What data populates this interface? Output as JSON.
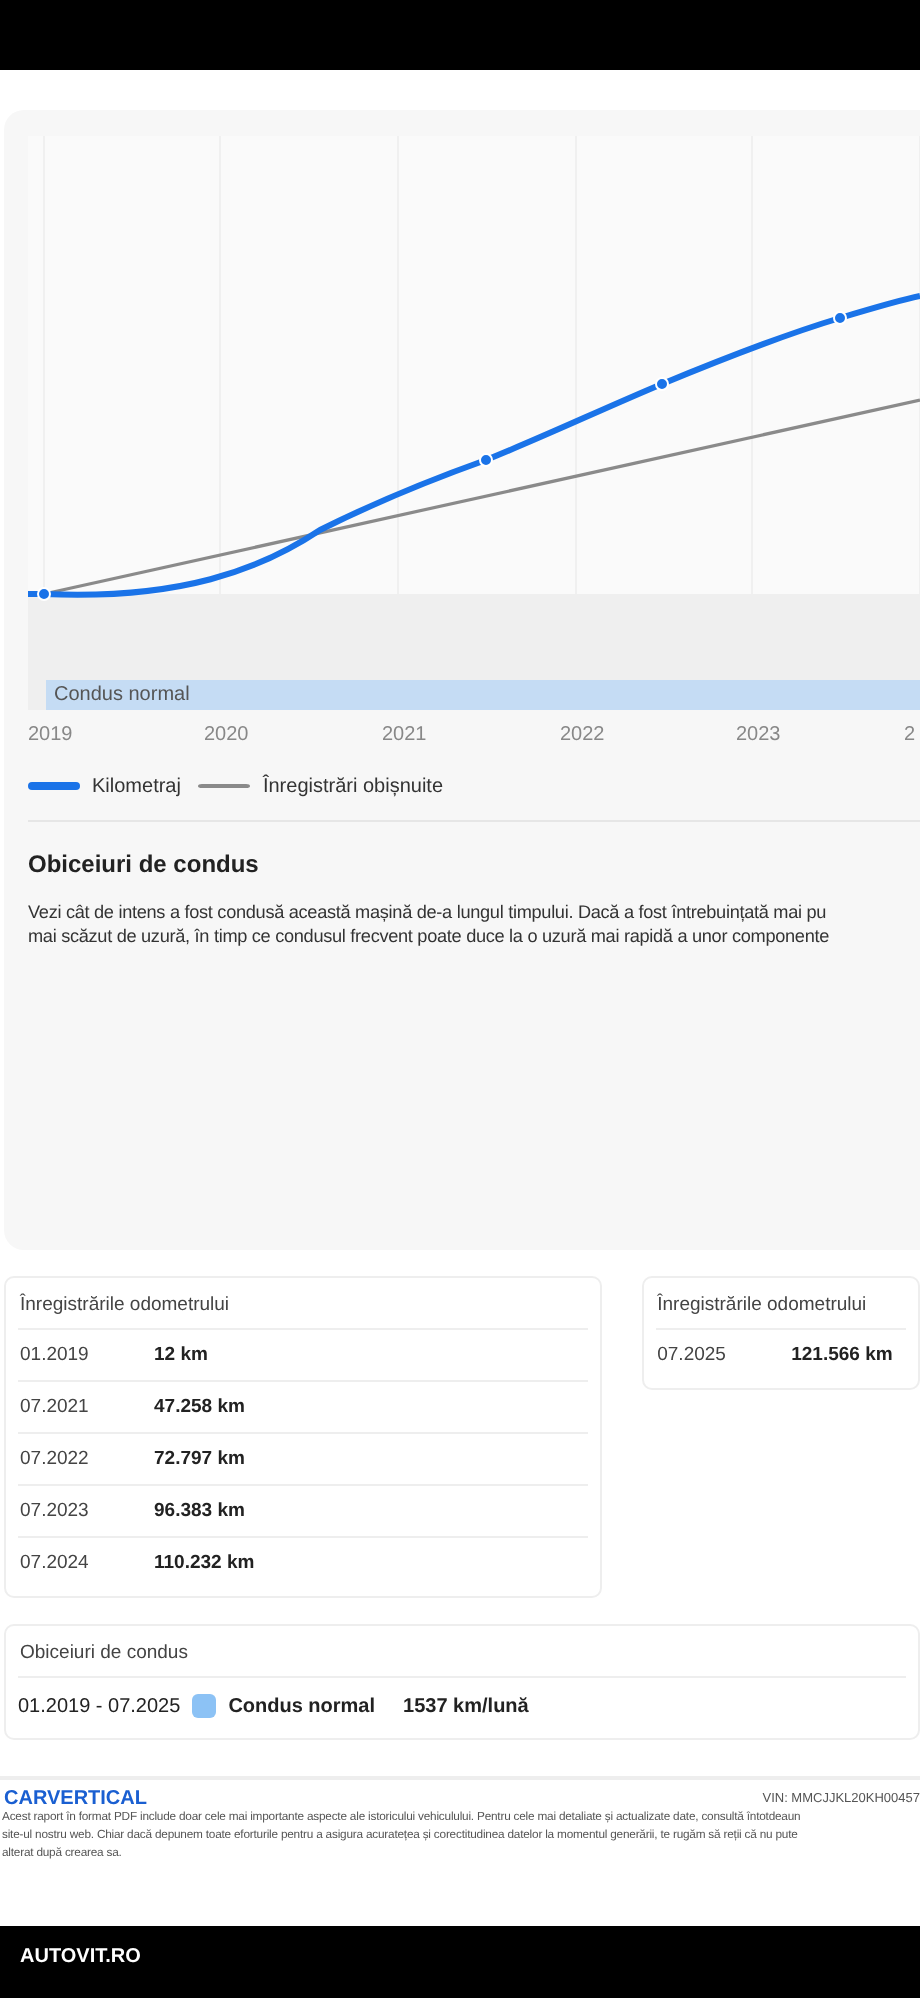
{
  "chart": {
    "band_label": "Condus normal",
    "x_labels": [
      "2019",
      "2020",
      "2021",
      "2022",
      "2023",
      "2"
    ],
    "legend": [
      {
        "label": "Kilometraj",
        "color": "#1a73e8"
      },
      {
        "label": "Înregistrări obișnuite",
        "color": "#8a8a8a"
      }
    ]
  },
  "habits": {
    "title": "Obiceiuri de condus",
    "lines": [
      "Vezi cât de intens a fost condusă această mașină de-a lungul timpului. Dacă a fost întrebuințată mai pu",
      "mai scăzut de uzură, în timp ce condusul frecvent poate duce la o uzură mai rapidă a unor componente"
    ]
  },
  "odometer_cards": [
    {
      "title": "Înregistrările odometrului",
      "rows": [
        {
          "date": "01.2019",
          "value": "12 km"
        },
        {
          "date": "07.2021",
          "value": "47.258 km"
        },
        {
          "date": "07.2022",
          "value": "72.797 km"
        },
        {
          "date": "07.2023",
          "value": "96.383 km"
        },
        {
          "date": "07.2024",
          "value": "110.232 km"
        }
      ]
    },
    {
      "title": "Înregistrările odometrului",
      "rows": [
        {
          "date": "07.2025",
          "value": "121.566 km"
        }
      ]
    }
  ],
  "driving_card": {
    "title": "Obiceiuri de condus",
    "rows": [
      {
        "period": "01.2019 - 07.2025",
        "color": "#8cc2f5",
        "label": "Condus normal",
        "rate": "1537 km/lună"
      }
    ]
  },
  "footer": {
    "logo": "CARVERTICAL",
    "vin": "VIN: MMCJJKL20KH00457",
    "lines": [
      "Acest raport în format PDF include doar cele mai importante aspecte ale istoricului vehiculului. Pentru cele mai detaliate și actualizate date, consultă întotdeaun",
      "site-ul nostru web. Chiar dacă depunem toate eforturile pentru a asigura acuratețea și corectitudinea datelor la momentul generării, te rugăm să reții că nu pute",
      "alterat după crearea sa."
    ]
  },
  "bottom_bar": {
    "brand": "AUTOVIT.RO"
  }
}
